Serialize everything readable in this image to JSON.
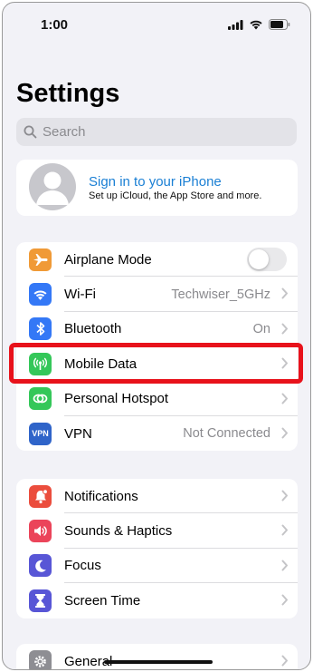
{
  "status_bar": {
    "time": "1:00"
  },
  "title": "Settings",
  "search": {
    "placeholder": "Search"
  },
  "profile": {
    "title": "Sign in to your iPhone",
    "subtitle": "Set up iCloud, the App Store and more."
  },
  "group1": [
    {
      "label": "Airplane Mode",
      "icon": "airplane-icon",
      "color": "#f09a37",
      "toggle": false
    },
    {
      "label": "Wi-Fi",
      "icon": "wifi-icon",
      "color": "#3478f6",
      "value": "Techwiser_5GHz"
    },
    {
      "label": "Bluetooth",
      "icon": "bluetooth-icon",
      "color": "#3478f6",
      "value": "On"
    },
    {
      "label": "Mobile Data",
      "icon": "antenna-icon",
      "color": "#34c759",
      "value": ""
    },
    {
      "label": "Personal Hotspot",
      "icon": "hotspot-icon",
      "color": "#34c759",
      "value": ""
    },
    {
      "label": "VPN",
      "icon": "vpn-icon",
      "icon_text": "VPN",
      "color": "#2f64c9",
      "value": "Not Connected"
    }
  ],
  "group2": [
    {
      "label": "Notifications",
      "icon": "bell-icon",
      "color": "#eb4d3d"
    },
    {
      "label": "Sounds & Haptics",
      "icon": "speaker-icon",
      "color": "#eb445a"
    },
    {
      "label": "Focus",
      "icon": "moon-icon",
      "color": "#5856d6"
    },
    {
      "label": "Screen Time",
      "icon": "hourglass-icon",
      "color": "#5856d6"
    }
  ],
  "group3": [
    {
      "label": "General",
      "icon": "gear-icon",
      "color": "#8e8e93"
    }
  ],
  "highlight_color": "#e8121b"
}
